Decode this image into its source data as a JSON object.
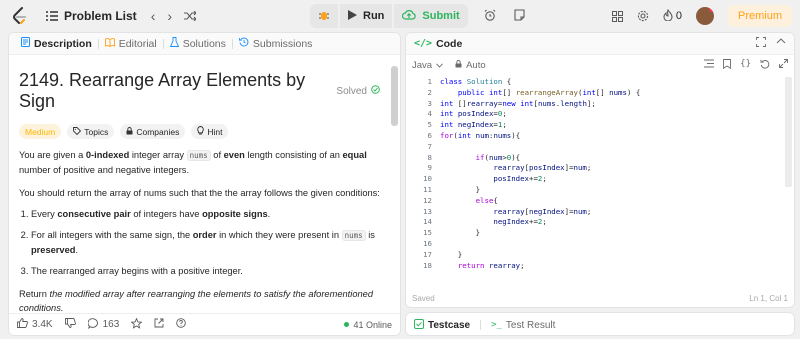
{
  "topbar": {
    "problem_list": "Problem List",
    "run": "Run",
    "submit": "Submit",
    "streak": "0",
    "premium": "Premium"
  },
  "left_tabs": [
    "Description",
    "Editorial",
    "Solutions",
    "Submissions"
  ],
  "problem": {
    "title": "2149. Rearrange Array Elements by Sign",
    "solved": "Solved",
    "badges": [
      "Medium",
      "Topics",
      "Companies",
      "Hint"
    ]
  },
  "footer": {
    "likes": "3.4K",
    "comments": "163",
    "online": "41 Online"
  },
  "code_panel": {
    "title": "Code",
    "language": "Java",
    "auto": "Auto",
    "status": "Saved",
    "cursor": "Ln 1, Col 1"
  },
  "bottom_tabs": [
    "Testcase",
    "Test Result"
  ],
  "colors": {
    "accent": "#ffa116",
    "success": "#2db55d"
  }
}
